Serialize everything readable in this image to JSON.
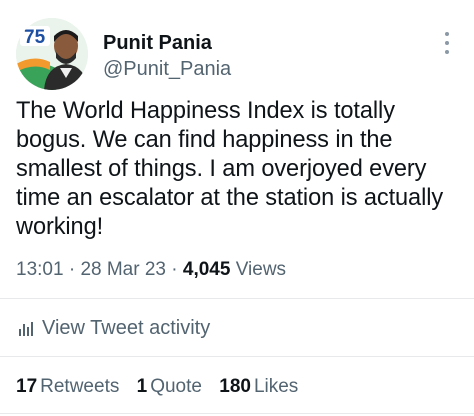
{
  "author": {
    "display_name": "Punit Pania",
    "handle": "@Punit_Pania",
    "avatar_badge": "75"
  },
  "tweet": {
    "text": "The World Happiness Index is totally bogus. We can find happiness in the smallest of things. I am overjoyed every time an escalator at the station is actually working!",
    "time": "13:01",
    "date": "28 Mar 23",
    "views_count": "4,045",
    "views_label": "Views",
    "separator": "·"
  },
  "activity": {
    "label": "View Tweet activity",
    "icon": "bar-chart-icon"
  },
  "stats": {
    "retweets_count": "17",
    "retweets_label": "Retweets",
    "quotes_count": "1",
    "quotes_label": "Quote",
    "likes_count": "180",
    "likes_label": "Likes"
  },
  "colors": {
    "text": "#0f1419",
    "muted": "#536471",
    "divider": "#e7e9ea"
  }
}
